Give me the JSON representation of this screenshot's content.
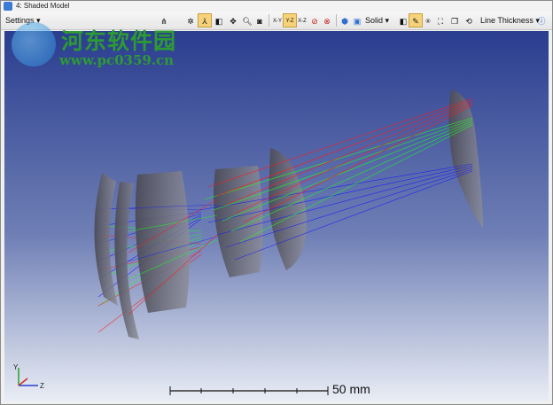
{
  "window": {
    "title": "4: Shaded Model"
  },
  "toolbar": {
    "settings_label": "Settings",
    "axis_labels": [
      "X-Y",
      "Y-Z",
      "X-Z"
    ],
    "active_axis": "Y-Z",
    "render_mode": "Solid",
    "line_thickness_label": "Line Thickness"
  },
  "watermark": {
    "text": "河东软件园",
    "url": "www.pc0359.cn"
  },
  "viewport": {
    "scale_bar_label": "50 mm",
    "axis_triad": {
      "y": "Y",
      "z": "Z"
    },
    "background_top": "#2a3d8f",
    "background_bottom": "#e9edf5"
  },
  "colors": {
    "ray_red": "#ff1a1a",
    "ray_green": "#1aff1a",
    "ray_blue": "#1a1aff",
    "lens_gray": "#7d7d8a"
  }
}
